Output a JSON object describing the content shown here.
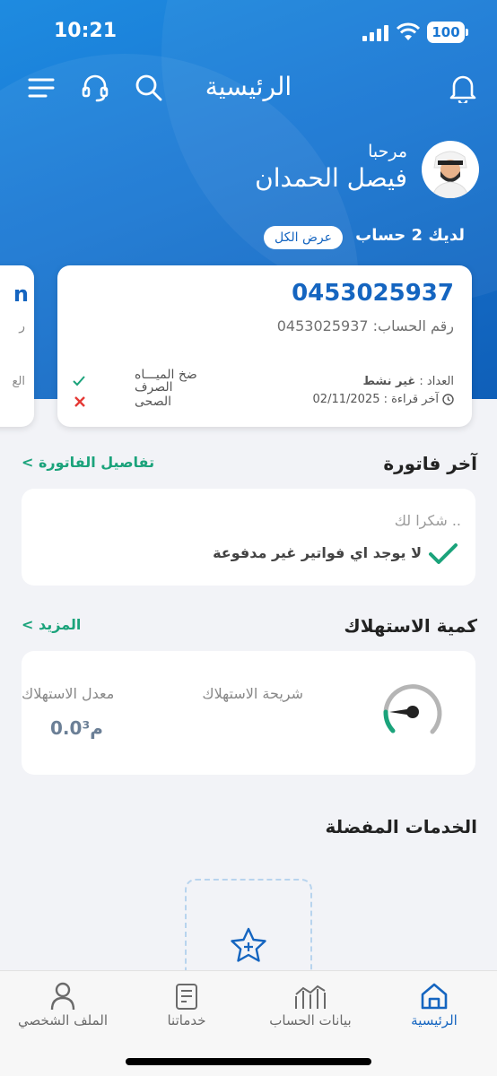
{
  "status": {
    "time": "10:21",
    "battery": "100"
  },
  "header": {
    "title": "الرئيسية"
  },
  "icons": {
    "notifications": "bell-icon",
    "search": "search-icon",
    "support": "headset-icon",
    "menu": "hamburger-icon"
  },
  "greeting": {
    "hello": "مرحبا",
    "name": "فيصل الحمدان"
  },
  "accounts": {
    "summary": "لديك 2 حساب",
    "view_all": "عرض الكل"
  },
  "account_card": {
    "number": "0453025937",
    "account_label": "رقم الحساب: 0453025937",
    "meter_label": "العداد : ",
    "meter_status": "غير نشط",
    "last_read": "آخر قراءة : 02/11/2025",
    "services": [
      {
        "label": "ضخ الميـــاه",
        "state": "ok"
      },
      {
        "label": "الصرف الصحى",
        "state": "no"
      }
    ]
  },
  "side_card": {
    "frag_title": "n",
    "frag_label": "ر",
    "frag_meter": "الع"
  },
  "last_bill": {
    "title": "آخر فاتورة",
    "link": "تفاصيل الفاتورة",
    "thanks": "شكرا لك ..",
    "message": "لا يوجد اي فواتير غير مدفوعة"
  },
  "consumption": {
    "title": "كمية الاستهلاك",
    "link": "المزيد",
    "tier_label": "شريحة الاستهلاك",
    "rate_label": "معدل الاستهلاك",
    "rate_value": "0.0م³"
  },
  "favorites": {
    "title": "الخدمات المفضلة"
  },
  "tabs": [
    {
      "label": "الرئيسية",
      "icon": "home-icon",
      "active": true
    },
    {
      "label": "بيانات الحساب",
      "icon": "chart-icon",
      "active": false
    },
    {
      "label": "خدماتنا",
      "icon": "services-icon",
      "active": false
    },
    {
      "label": "الملف الشخصي",
      "icon": "profile-icon",
      "active": false
    }
  ],
  "colors": {
    "primary": "#1976d2",
    "accent_green": "#1ba37b",
    "error_red": "#e53935"
  }
}
